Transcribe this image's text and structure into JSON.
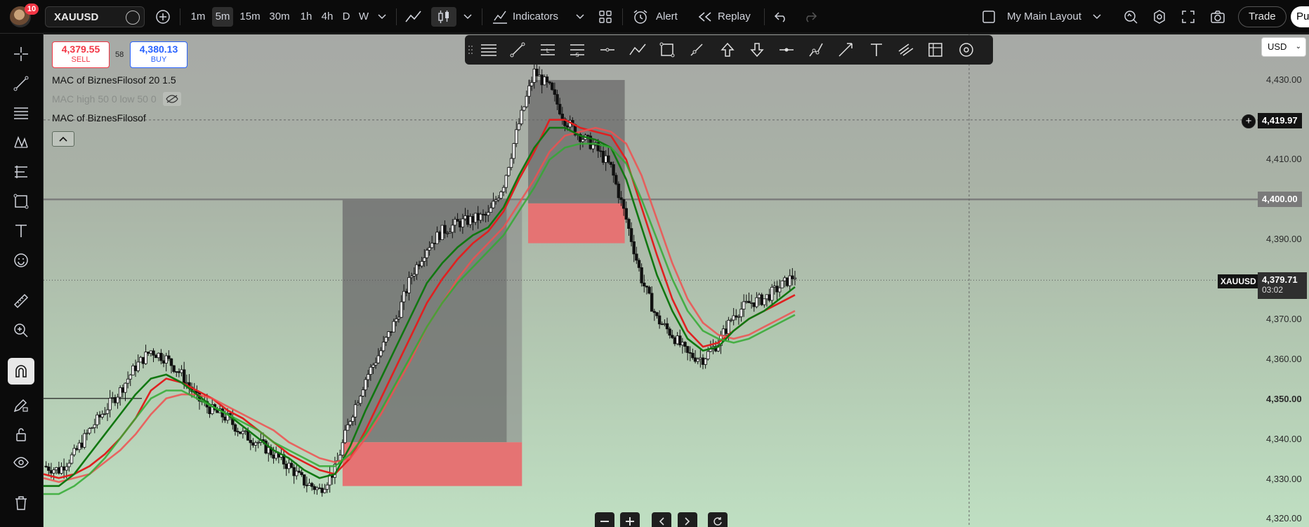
{
  "topbar": {
    "notification_count": "10",
    "symbol": "XAUUSD",
    "timeframes": [
      "1m",
      "5m",
      "15m",
      "30m",
      "1h",
      "4h",
      "D",
      "W"
    ],
    "active_timeframe": "5m",
    "indicators_label": "Indicators",
    "alert_label": "Alert",
    "replay_label": "Replay",
    "layout_label": "My Main Layout",
    "trade_label": "Trade",
    "publish_label": "Pu"
  },
  "order": {
    "sell_price": "4,379.55",
    "sell_label": "SELL",
    "spread": "58",
    "buy_price": "4,380.13",
    "buy_label": "BUY"
  },
  "legend": {
    "line1": "MAC of BiznesFilosof 20 1.5",
    "line2": "MAC high 50 0 low 50 0",
    "line3": "MAC of BiznesFilosof"
  },
  "price_scale": {
    "currency": "USD",
    "ticks": [
      "4,430.00",
      "4,410.00",
      "4,390.00",
      "4,370.00",
      "4,360.00",
      "4,350.00",
      "4,340.00",
      "4,330.00",
      "4,320.00"
    ],
    "crosshair_price": "4,419.97",
    "line_price": "4,400.00",
    "current_symbol": "XAUUSD",
    "current_price": "4,379.71",
    "countdown": "03:02"
  },
  "colors": {
    "ma_fast": "#e02020",
    "ma_slow_red": "#f05050",
    "ma_green_fast": "#117711",
    "ma_green_slow": "#33aa33",
    "zone_red": "#e57373",
    "zone_gray": "#6e6e6e",
    "sell": "#f23645",
    "buy": "#2962ff"
  },
  "chart_data": {
    "type": "line",
    "title": "",
    "xlabel": "",
    "ylabel": "",
    "ylim": [
      4316,
      4440
    ],
    "series": [
      {
        "color": "#111111",
        "values": [
          4333,
          4332,
          4336,
          4342,
          4347,
          4352,
          4358,
          4362,
          4360,
          4356,
          4350,
          4347,
          4345,
          4341,
          4339,
          4336,
          4333,
          4329,
          4327,
          4332,
          4345,
          4355,
          4362,
          4370,
          4381,
          4388,
          4392,
          4394,
          4395,
          4396,
          4404,
          4419,
          4432,
          4428,
          4420,
          4416,
          4413,
          4408,
          4395,
          4380,
          4370,
          4366,
          4361,
          4360,
          4364,
          4371,
          4374,
          4375,
          4378,
          4381
        ]
      },
      {
        "color": "#e02020",
        "values": [
          4331,
          4330,
          4331,
          4333,
          4336,
          4340,
          4345,
          4352,
          4355,
          4354,
          4352,
          4350,
          4347,
          4345,
          4342,
          4339,
          4336,
          4334,
          4332,
          4331,
          4335,
          4342,
          4350,
          4358,
          4366,
          4374,
          4380,
          4385,
          4389,
          4392,
          4397,
          4405,
          4412,
          4420,
          4420,
          4418,
          4417,
          4416,
          4410,
          4398,
          4386,
          4375,
          4367,
          4363,
          4364,
          4367,
          4370,
          4372,
          4374,
          4376
        ]
      },
      {
        "color": "#f05050",
        "values": [
          4330,
          4329,
          4330,
          4331,
          4334,
          4337,
          4341,
          4346,
          4350,
          4351,
          4351,
          4350,
          4348,
          4346,
          4344,
          4342,
          4339,
          4337,
          4335,
          4334,
          4335,
          4340,
          4346,
          4353,
          4360,
          4368,
          4374,
          4380,
          4385,
          4389,
          4393,
          4399,
          4405,
          4412,
          4416,
          4417,
          4418,
          4417,
          4414,
          4406,
          4395,
          4384,
          4375,
          4369,
          4366,
          4365,
          4366,
          4368,
          4370,
          4372
        ]
      },
      {
        "color": "#117711",
        "values": [
          4328,
          4328,
          4331,
          4336,
          4341,
          4346,
          4351,
          4355,
          4356,
          4354,
          4351,
          4348,
          4346,
          4343,
          4340,
          4337,
          4335,
          4332,
          4330,
          4331,
          4338,
          4347,
          4355,
          4363,
          4371,
          4379,
          4384,
          4388,
          4391,
          4393,
          4398,
          4406,
          4413,
          4418,
          4418,
          4416,
          4415,
          4413,
          4405,
          4393,
          4381,
          4372,
          4365,
          4362,
          4363,
          4367,
          4370,
          4372,
          4375,
          4378
        ]
      },
      {
        "color": "#33aa33",
        "values": [
          4326,
          4326,
          4328,
          4331,
          4335,
          4340,
          4345,
          4350,
          4352,
          4352,
          4350,
          4348,
          4346,
          4344,
          4342,
          4339,
          4337,
          4335,
          4333,
          4333,
          4336,
          4341,
          4347,
          4354,
          4361,
          4368,
          4374,
          4379,
          4383,
          4387,
          4391,
          4397,
          4403,
          4410,
          4413,
          4414,
          4414,
          4413,
          4409,
          4400,
          4390,
          4380,
          4372,
          4367,
          4365,
          4364,
          4365,
          4367,
          4369,
          4371
        ]
      }
    ]
  }
}
